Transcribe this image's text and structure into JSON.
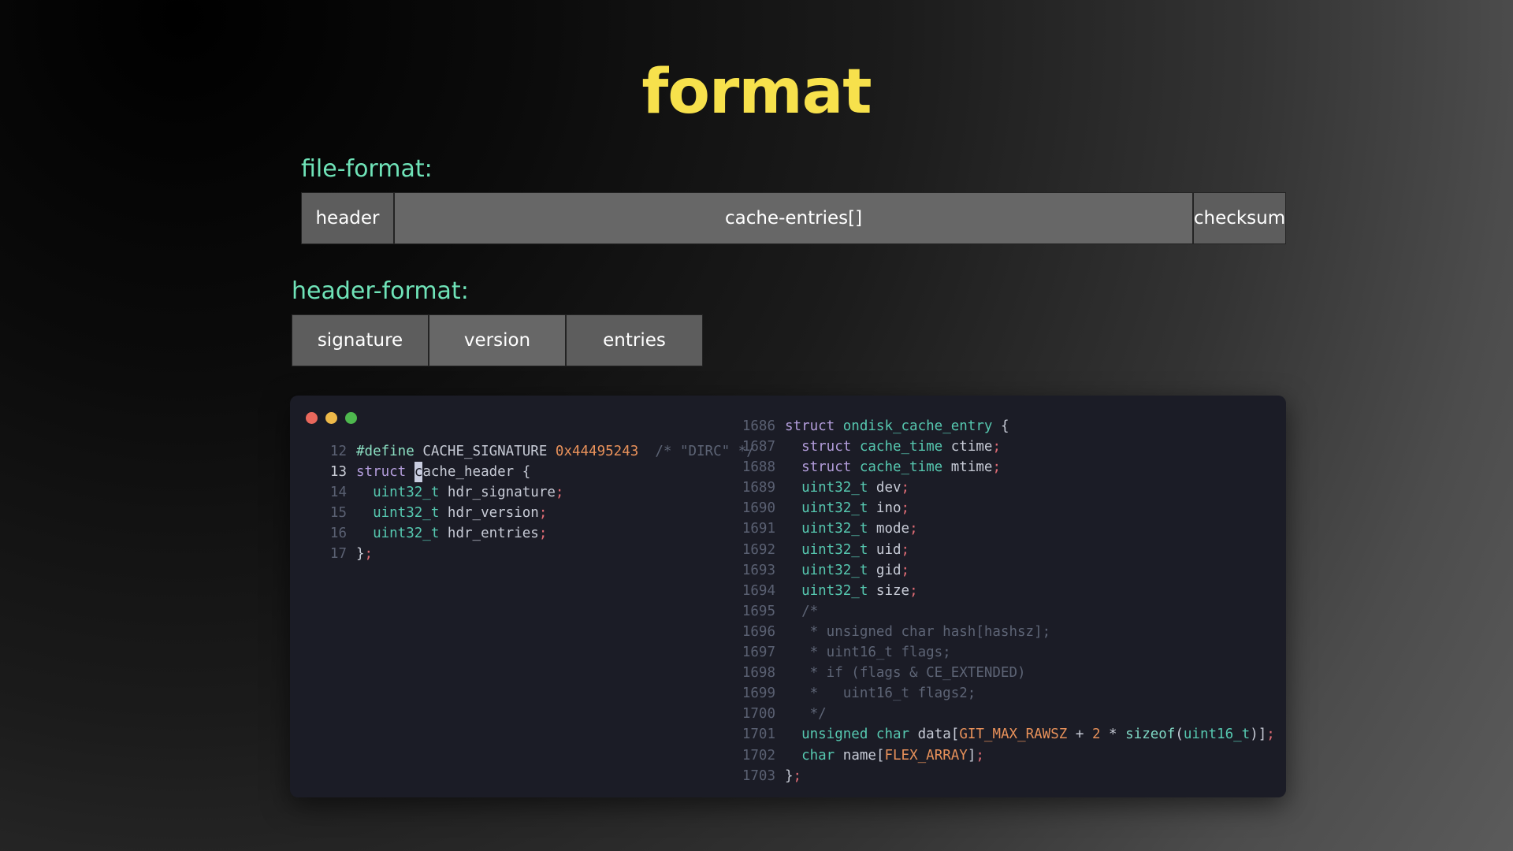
{
  "slide": {
    "title": "format",
    "title_color": "#f7e14c",
    "accent_color": "#6fe3b8",
    "background_from": "#000000",
    "background_to": "#5b5b5b"
  },
  "file_format": {
    "label": "file-format:",
    "boxes": [
      {
        "name": "header",
        "label": "header"
      },
      {
        "name": "cache-entries",
        "label": "cache-entries[]"
      },
      {
        "name": "checksum",
        "label": "checksum"
      }
    ]
  },
  "header_format": {
    "label": "header-format:",
    "boxes": [
      {
        "name": "signature",
        "label": "signature"
      },
      {
        "name": "version",
        "label": "version"
      },
      {
        "name": "entries",
        "label": "entries"
      }
    ]
  },
  "code_window": {
    "background": "#1b1c26",
    "traffic_lights": [
      {
        "name": "close-dot",
        "color": "#e9685c"
      },
      {
        "name": "minimize-dot",
        "color": "#eeb949"
      },
      {
        "name": "maximize-dot",
        "color": "#4eb84e"
      }
    ],
    "left_pane": {
      "active_line": 13,
      "lines": [
        {
          "no": "12",
          "text": "#define CACHE_SIGNATURE 0x44495243  /* \"DIRC\" */"
        },
        {
          "no": "13",
          "text": "struct cache_header {"
        },
        {
          "no": "14",
          "text": "    uint32_t hdr_signature;"
        },
        {
          "no": "15",
          "text": "    uint32_t hdr_version;"
        },
        {
          "no": "16",
          "text": "    uint32_t hdr_entries;"
        },
        {
          "no": "17",
          "text": "};"
        }
      ]
    },
    "right_pane": {
      "lines": [
        {
          "no": "1686",
          "text": "struct ondisk_cache_entry {"
        },
        {
          "no": "1687",
          "text": "    struct cache_time ctime;"
        },
        {
          "no": "1688",
          "text": "    struct cache_time mtime;"
        },
        {
          "no": "1689",
          "text": "    uint32_t dev;"
        },
        {
          "no": "1690",
          "text": "    uint32_t ino;"
        },
        {
          "no": "1691",
          "text": "    uint32_t mode;"
        },
        {
          "no": "1692",
          "text": "    uint32_t uid;"
        },
        {
          "no": "1693",
          "text": "    uint32_t gid;"
        },
        {
          "no": "1694",
          "text": "    uint32_t size;"
        },
        {
          "no": "1695",
          "text": "    /*"
        },
        {
          "no": "1696",
          "text": "     * unsigned char hash[hashsz];"
        },
        {
          "no": "1697",
          "text": "     * uint16_t flags;"
        },
        {
          "no": "1698",
          "text": "     * if (flags & CE_EXTENDED)"
        },
        {
          "no": "1699",
          "text": "     *   uint16_t flags2;"
        },
        {
          "no": "1700",
          "text": "     */"
        },
        {
          "no": "1701",
          "text": "    unsigned char data[GIT_MAX_RAWSZ + 2 * sizeof(uint16_t)];"
        },
        {
          "no": "1702",
          "text": "    char name[FLEX_ARRAY];"
        },
        {
          "no": "1703",
          "text": "};"
        }
      ]
    }
  }
}
